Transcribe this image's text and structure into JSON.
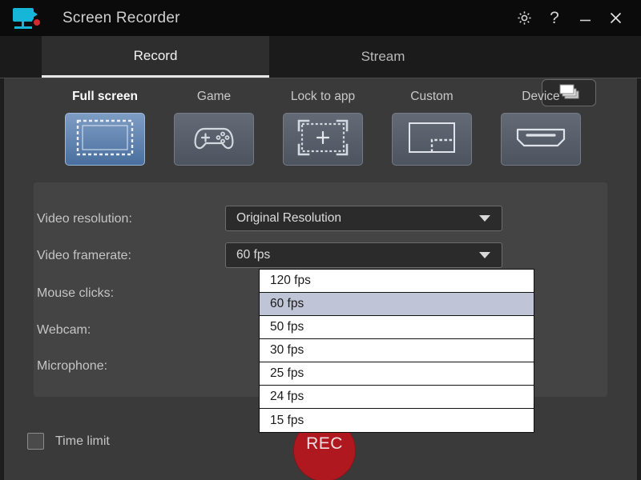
{
  "window": {
    "title": "Screen Recorder",
    "app_icon": "screen-recorder-icon",
    "controls": [
      {
        "name": "settings-gear",
        "glyph": "⚙"
      },
      {
        "name": "help",
        "glyph": "?"
      },
      {
        "name": "minimize",
        "glyph": "—"
      },
      {
        "name": "close",
        "glyph": "✕"
      }
    ]
  },
  "tabs": {
    "items": [
      {
        "label": "Record",
        "active": true
      },
      {
        "label": "Stream",
        "active": false
      }
    ],
    "layers_button": "layers-icon"
  },
  "modes": {
    "items": [
      {
        "label": "Full screen",
        "icon": "full-screen-icon",
        "selected": true
      },
      {
        "label": "Game",
        "icon": "gamepad-icon",
        "selected": false
      },
      {
        "label": "Lock to app",
        "icon": "lock-to-app-icon",
        "selected": false
      },
      {
        "label": "Custom",
        "icon": "custom-region-icon",
        "selected": false
      },
      {
        "label": "Device",
        "icon": "hdmi-device-icon",
        "selected": false
      }
    ]
  },
  "settings": {
    "rows": [
      {
        "label": "Video resolution:",
        "value": "Original Resolution"
      },
      {
        "label": "Video framerate:",
        "value": "60 fps"
      },
      {
        "label": "Mouse clicks:",
        "value": ""
      },
      {
        "label": "Webcam:",
        "value": ""
      },
      {
        "label": "Microphone:",
        "value": ""
      }
    ]
  },
  "framerate_dropdown": {
    "open": true,
    "options": [
      {
        "label": "120 fps",
        "selected": false
      },
      {
        "label": "60 fps",
        "selected": true
      },
      {
        "label": "50 fps",
        "selected": false
      },
      {
        "label": "30 fps",
        "selected": false
      },
      {
        "label": "25 fps",
        "selected": false
      },
      {
        "label": "24 fps",
        "selected": false
      },
      {
        "label": "15 fps",
        "selected": false
      }
    ]
  },
  "footer": {
    "time_limit_label": "Time limit",
    "time_limit_checked": false,
    "record_button_label": "REC"
  },
  "colors": {
    "titlebar_bg": "#0b0b0b",
    "window_bg": "#3a3a3a",
    "panel_bg": "#444444",
    "accent_blue": "#5c82b4",
    "record_red": "#b01820",
    "logo_cyan": "#15b6d8",
    "highlight_row": "#bfc5d7"
  }
}
